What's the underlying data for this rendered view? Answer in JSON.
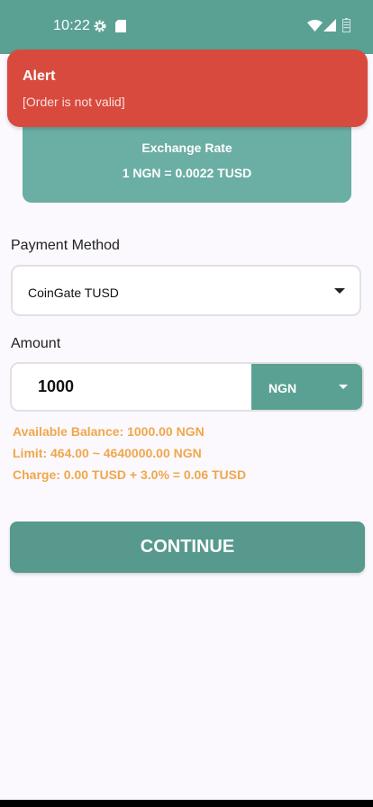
{
  "status_bar": {
    "time": "10:22",
    "icons": [
      "gear-icon",
      "sd-card-icon",
      "wifi-icon",
      "signal-icon",
      "battery-icon"
    ]
  },
  "alert": {
    "title": "Alert",
    "message": "[Order is not valid]",
    "color": "#d84a3d"
  },
  "exchange": {
    "title": "Exchange Rate",
    "rate": "1 NGN = 0.0022 TUSD"
  },
  "payment": {
    "label": "Payment Method",
    "selected": "CoinGate TUSD"
  },
  "amount": {
    "label": "Amount",
    "value": "1000",
    "currency": "NGN"
  },
  "info": {
    "balance": "Available Balance: 1000.00 NGN",
    "limit": "Limit: 464.00 ~ 4640000.00 NGN",
    "charge": "Charge: 0.00 TUSD + 3.0% = 0.06 TUSD"
  },
  "continue_label": "CONTINUE",
  "colors": {
    "primary": "#5aa193",
    "accent_text": "#f0a74b",
    "background": "#fbf9fe"
  }
}
